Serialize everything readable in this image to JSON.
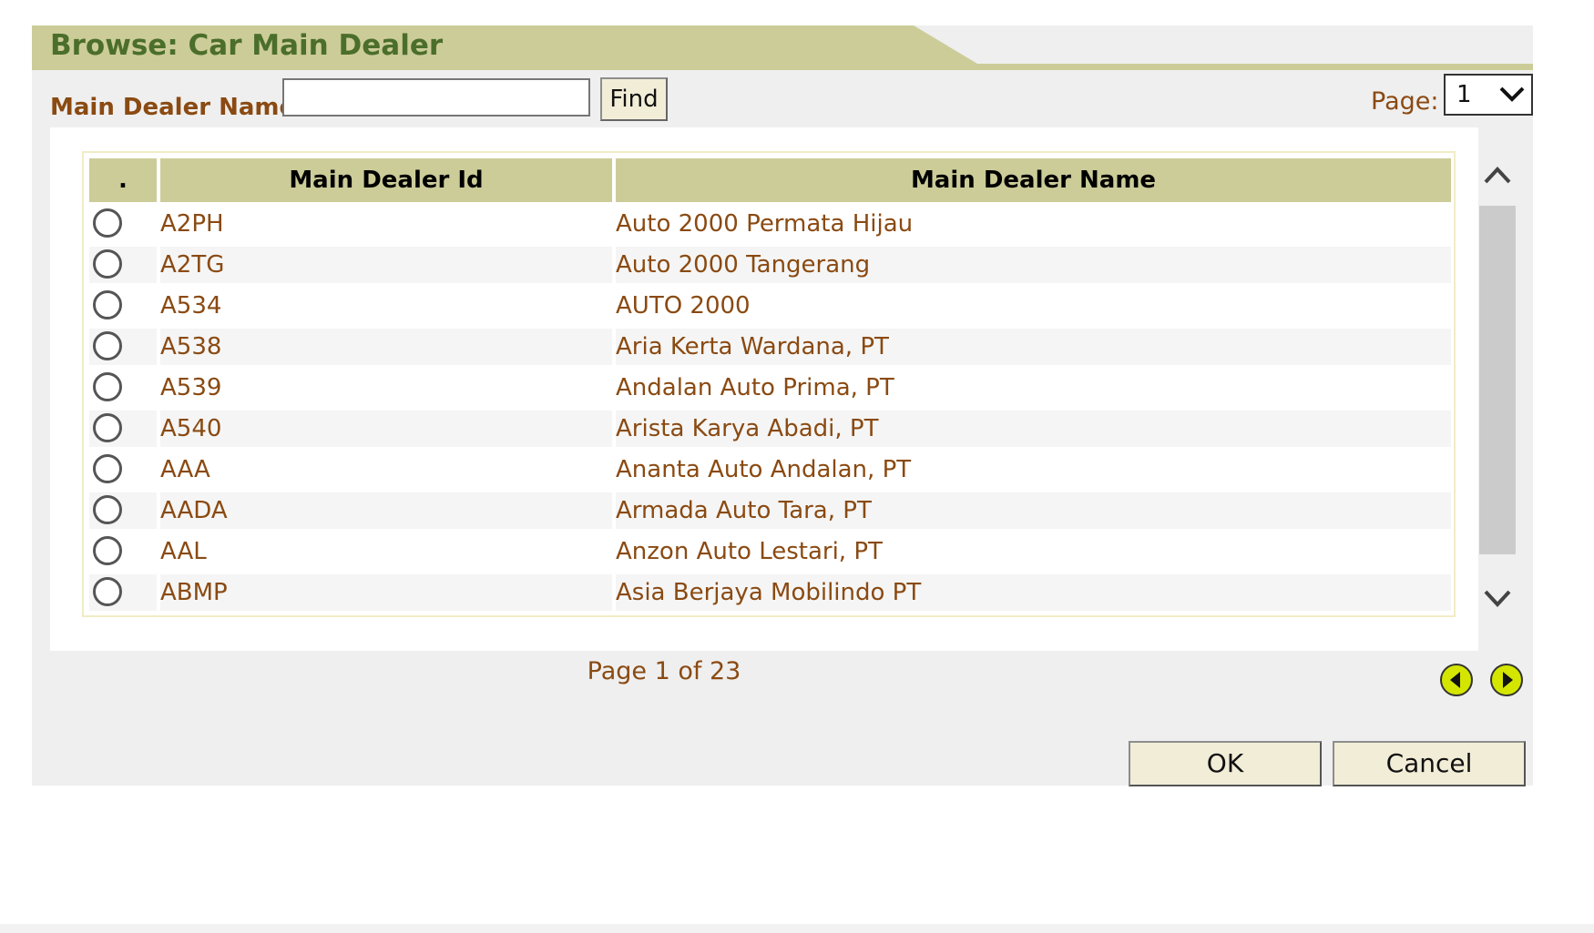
{
  "dialog": {
    "title": "Browse: Car Main Dealer"
  },
  "search": {
    "label": "Main Dealer Name:",
    "value": "",
    "placeholder": "",
    "find_label": "Find"
  },
  "paging": {
    "page_label": "Page:",
    "page_value": "1",
    "status": "Page 1 of 23"
  },
  "table": {
    "columns": [
      ".",
      "Main Dealer Id",
      "Main Dealer Name"
    ],
    "rows": [
      {
        "id": "A2PH",
        "name": "Auto 2000 Permata Hijau"
      },
      {
        "id": "A2TG",
        "name": "Auto 2000 Tangerang"
      },
      {
        "id": "A534",
        "name": "AUTO 2000"
      },
      {
        "id": "A538",
        "name": "Aria Kerta Wardana, PT"
      },
      {
        "id": "A539",
        "name": "Andalan Auto Prima, PT"
      },
      {
        "id": "A540",
        "name": "Arista Karya Abadi, PT"
      },
      {
        "id": "AAA",
        "name": "Ananta Auto Andalan, PT"
      },
      {
        "id": "AADA",
        "name": "Armada Auto Tara, PT"
      },
      {
        "id": "AAL",
        "name": "Anzon Auto Lestari, PT"
      },
      {
        "id": "ABMP",
        "name": "Asia Berjaya Mobilindo PT"
      }
    ]
  },
  "buttons": {
    "ok": "OK",
    "cancel": "Cancel"
  },
  "icons": {
    "scroll_up": "chevron-up-icon",
    "scroll_down": "chevron-down-icon",
    "prev": "prev-page-icon",
    "next": "next-page-icon",
    "select": "chevron-down-icon"
  },
  "colors": {
    "title": "#4b6e2b",
    "accent": "#cccc99",
    "label": "#8a4a12",
    "nav_button": "#d4e600"
  }
}
